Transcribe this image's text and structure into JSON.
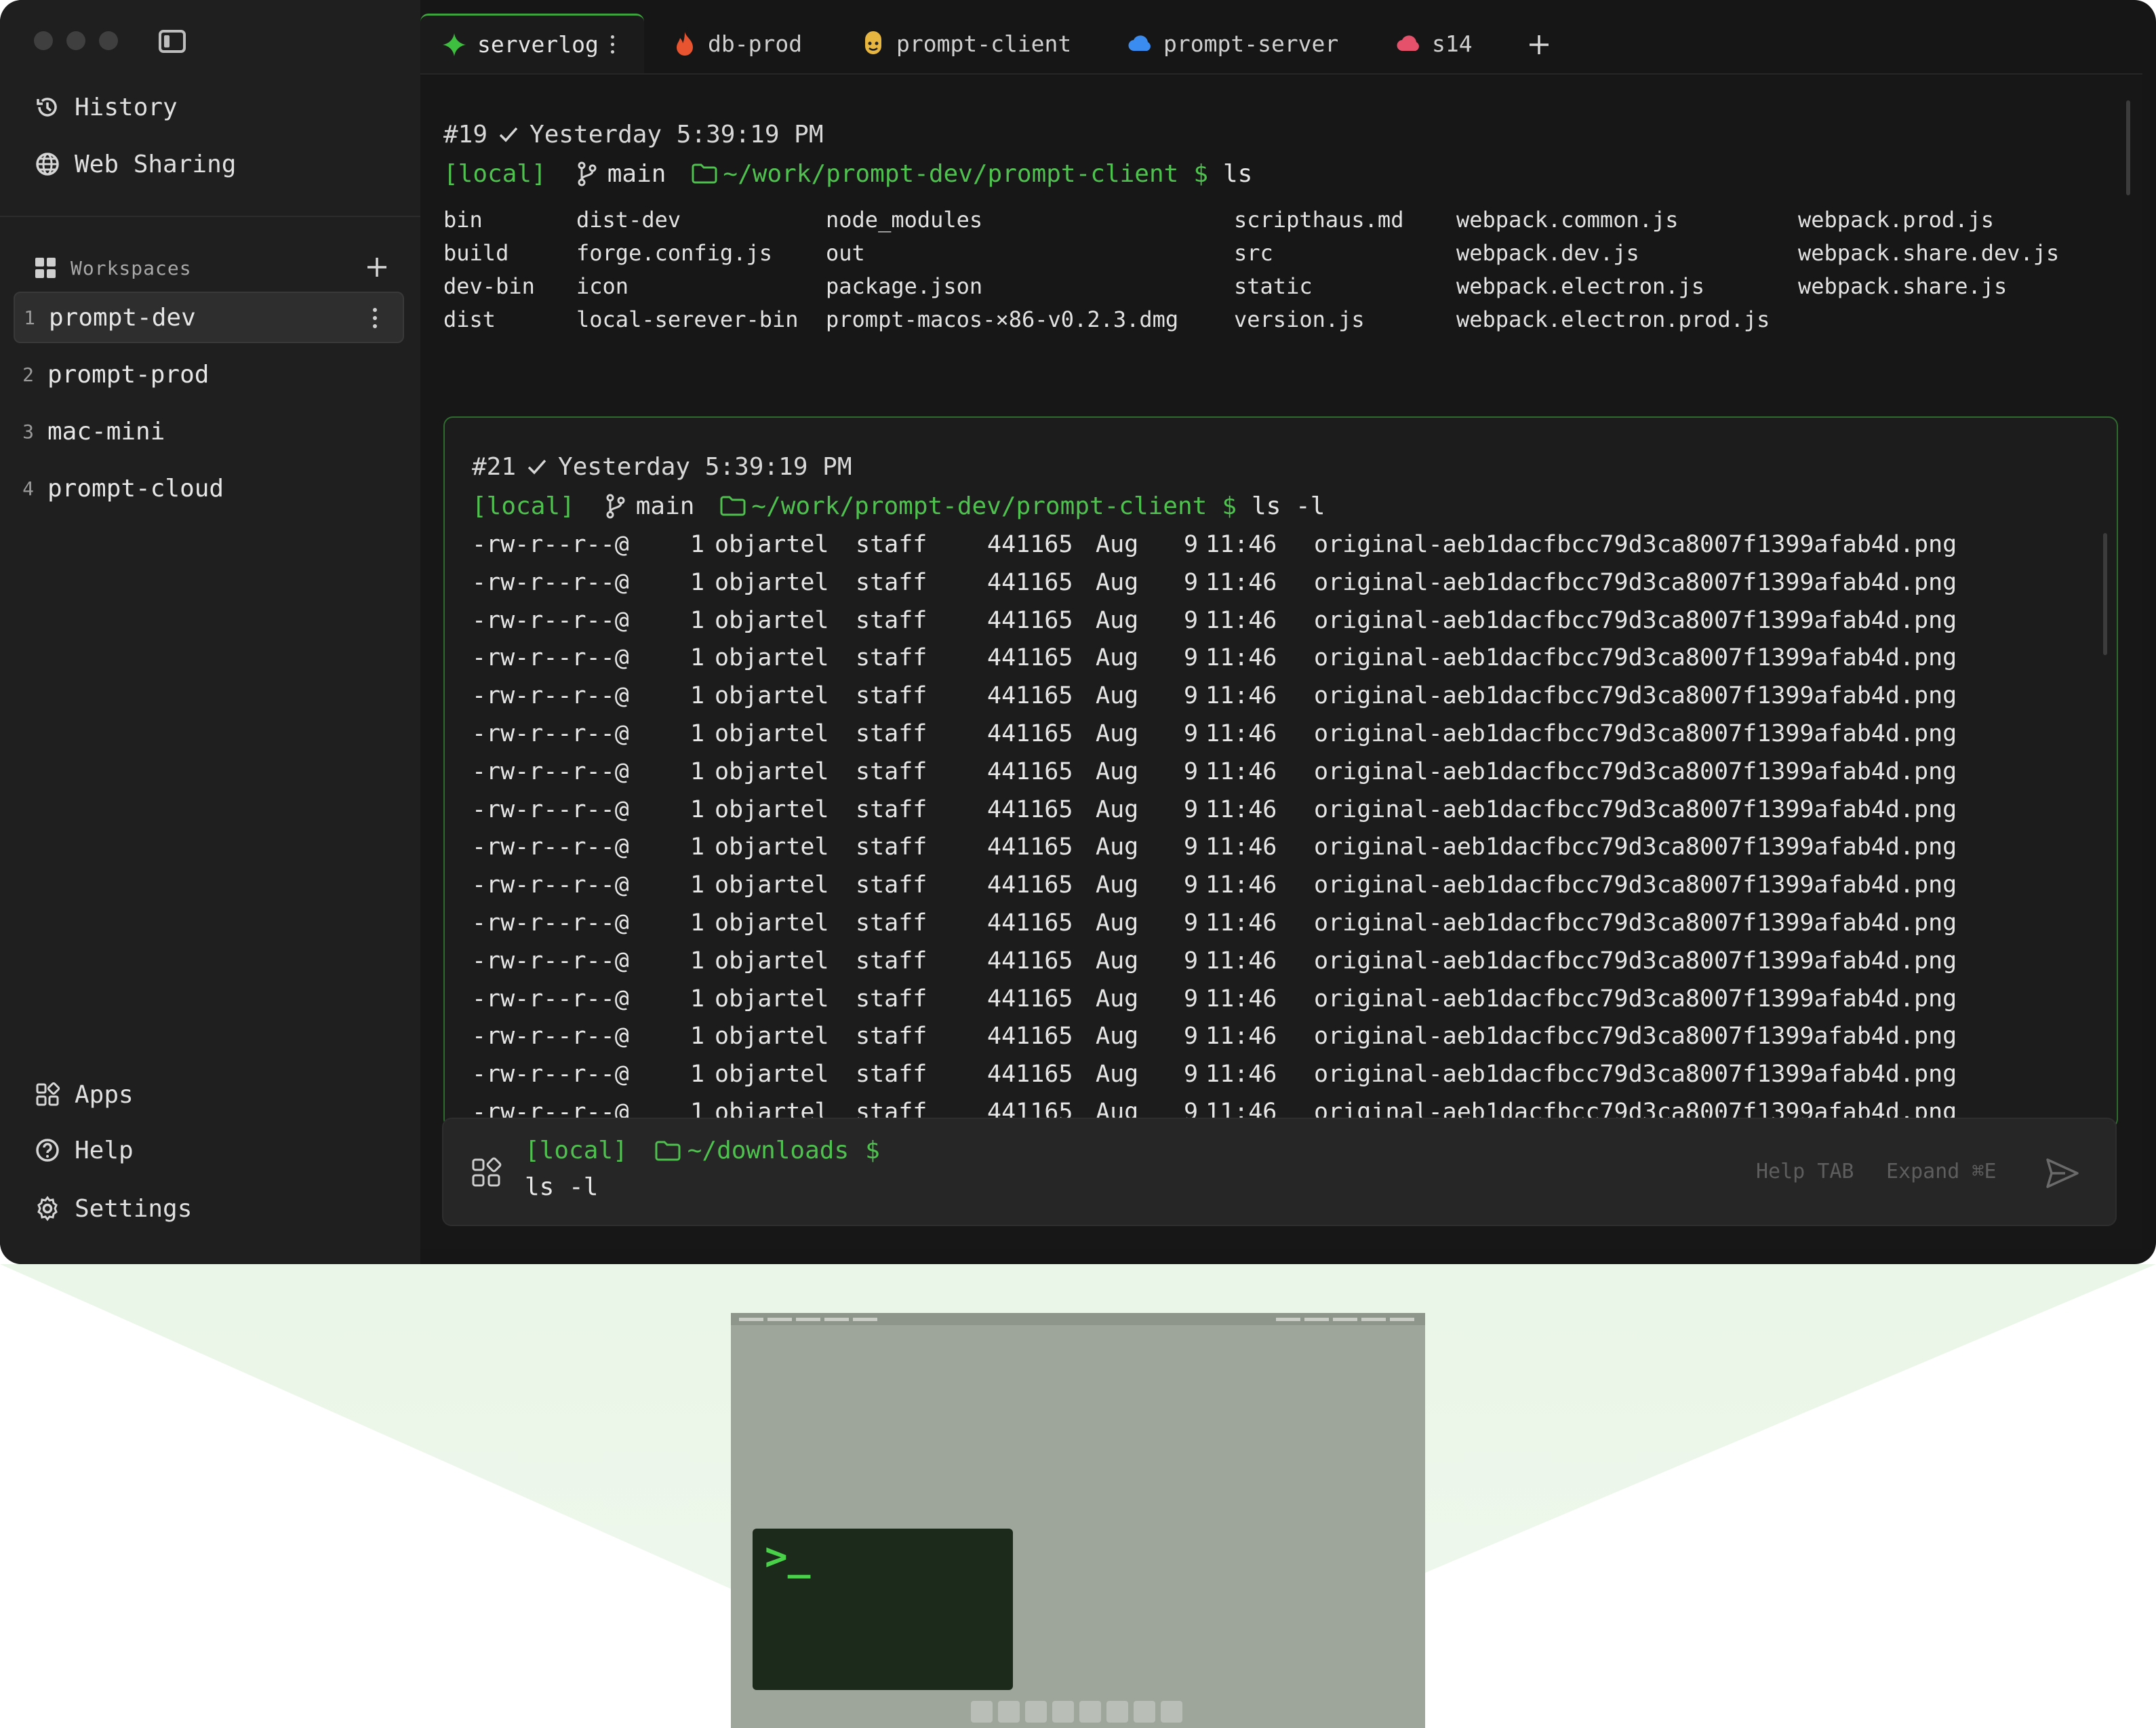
{
  "sidebar": {
    "nav": [
      {
        "label": "History",
        "icon": "history-icon"
      },
      {
        "label": "Web Sharing",
        "icon": "globe-icon"
      }
    ],
    "workspaces_title": "Workspaces",
    "workspaces": [
      {
        "num": "1",
        "label": "prompt-dev",
        "active": true
      },
      {
        "num": "2",
        "label": "prompt-prod"
      },
      {
        "num": "3",
        "label": "mac-mini"
      },
      {
        "num": "4",
        "label": "prompt-cloud"
      }
    ],
    "bottom": [
      {
        "label": "Apps",
        "icon": "apps-icon"
      },
      {
        "label": "Help",
        "icon": "help-icon"
      },
      {
        "label": "Settings",
        "icon": "gear-icon"
      }
    ]
  },
  "tabs": [
    {
      "label": "serverlog",
      "icon": "sparkle-icon",
      "active": true
    },
    {
      "label": "db-prod",
      "icon": "flame-icon"
    },
    {
      "label": "prompt-client",
      "icon": "face-icon"
    },
    {
      "label": "prompt-server",
      "icon": "cloud-icon"
    },
    {
      "label": "s14",
      "icon": "cloud-icon"
    }
  ],
  "colors": {
    "accent": "#4fc14f",
    "background": "#161616"
  },
  "block1": {
    "num": "#19",
    "time": "Yesterday 5:39:19 PM",
    "host": "[local]",
    "branch": "main",
    "path": "~/work/prompt-dev/prompt-client",
    "dollar": "$",
    "cmd": "ls",
    "columns": [
      [
        "bin",
        "build",
        "dev-bin",
        "dist"
      ],
      [
        "dist-dev",
        "forge.config.js",
        "icon",
        "local-serever-bin"
      ],
      [
        "node_modules",
        "out",
        "package.json",
        "prompt-macos-×86-v0.2.3.dmg"
      ],
      [
        "scripthaus.md",
        "src",
        "static",
        "version.js"
      ],
      [
        "webpack.common.js",
        "webpack.dev.js",
        "webpack.electron.js",
        "webpack.electron.prod.js"
      ],
      [
        "webpack.prod.js",
        "webpack.share.dev.js",
        "webpack.share.js"
      ]
    ]
  },
  "block2": {
    "num": "#21",
    "time": "Yesterday 5:39:19 PM",
    "host": "[local]",
    "branch": "main",
    "path": "~/work/prompt-dev/prompt-client",
    "dollar": "$",
    "cmd": "ls -l",
    "row": {
      "perm": "-rw-r--r--@",
      "links": "1",
      "owner": "objartel",
      "group": "staff",
      "size": "441165",
      "month": "Aug",
      "day": "9",
      "time": "11:46",
      "name": "original-aeb1dacfbcc79d3ca8007f1399afab4d.png"
    },
    "row_count": 16
  },
  "input": {
    "host": "[local]",
    "path": "~/downloads",
    "dollar": "$",
    "cmd": "ls -l",
    "help": "Help TAB",
    "expand": "Expand ⌘E"
  }
}
